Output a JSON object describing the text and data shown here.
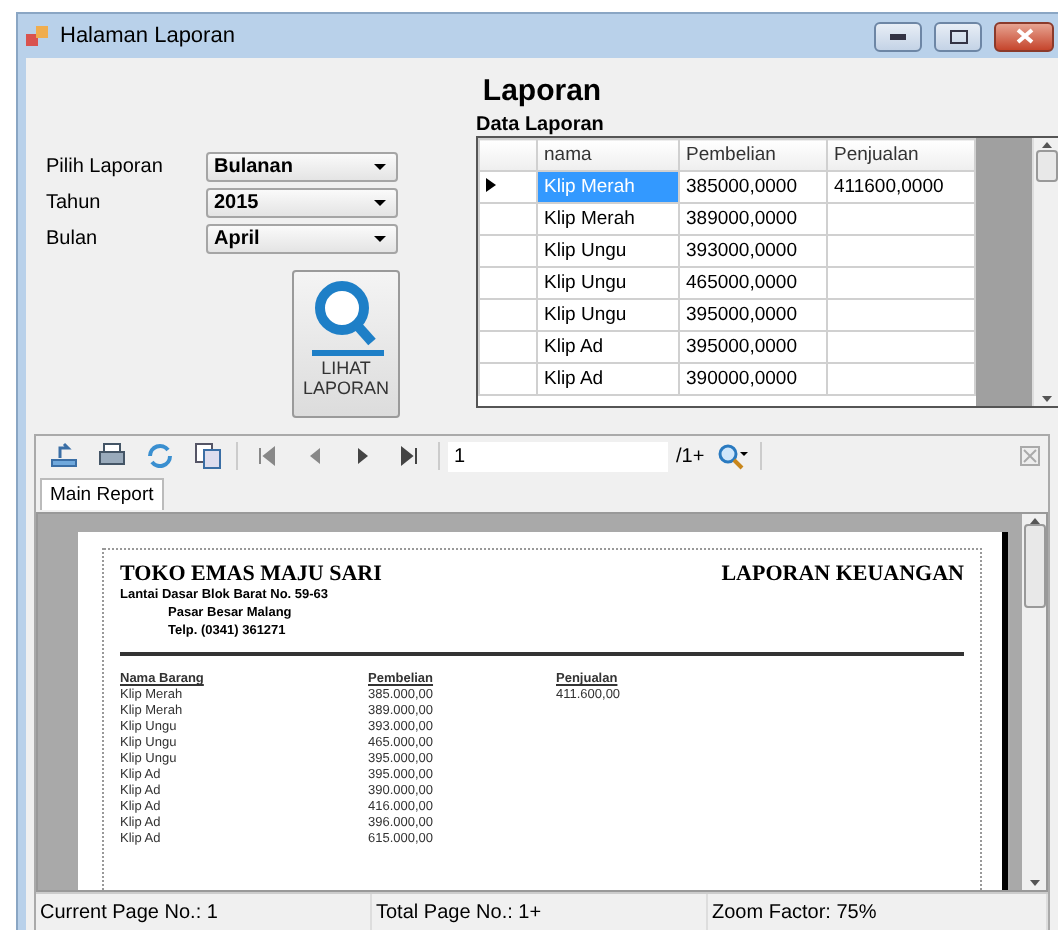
{
  "window": {
    "title": "Halaman Laporan"
  },
  "heading": "Laporan",
  "filters": [
    {
      "label": "Pilih Laporan",
      "value": "Bulanan"
    },
    {
      "label": "Tahun",
      "value": "2015"
    },
    {
      "label": "Bulan",
      "value": "April"
    }
  ],
  "view_button": "LIHAT LAPORAN",
  "grid": {
    "title": "Data Laporan",
    "columns": [
      "nama",
      "Pembelian",
      "Penjualan"
    ],
    "rows": [
      {
        "selected": true,
        "cells": [
          "Klip Merah",
          "385000,0000",
          "411600,0000"
        ]
      },
      {
        "selected": false,
        "cells": [
          "Klip Merah",
          "389000,0000",
          ""
        ]
      },
      {
        "selected": false,
        "cells": [
          "Klip Ungu",
          "393000,0000",
          ""
        ]
      },
      {
        "selected": false,
        "cells": [
          "Klip Ungu",
          "465000,0000",
          ""
        ]
      },
      {
        "selected": false,
        "cells": [
          "Klip Ungu",
          "395000,0000",
          ""
        ]
      },
      {
        "selected": false,
        "cells": [
          "Klip Ad",
          "395000,0000",
          ""
        ]
      },
      {
        "selected": false,
        "cells": [
          "Klip Ad",
          "390000,0000",
          ""
        ]
      }
    ]
  },
  "viewer": {
    "page_field": "1",
    "page_total": "/1+",
    "tab": "Main Report",
    "report": {
      "store_name": "TOKO EMAS MAJU SARI",
      "address_lines": [
        "Lantai Dasar Blok Barat No. 59-63",
        "Pasar Besar Malang",
        "Telp. (0341) 361271"
      ],
      "title": "LAPORAN KEUANGAN",
      "columns": [
        "Nama Barang",
        "Pembelian",
        "Penjualan"
      ],
      "rows": [
        [
          "Klip Merah",
          "385.000,00",
          "411.600,00"
        ],
        [
          "Klip Merah",
          "389.000,00",
          ""
        ],
        [
          "Klip Ungu",
          "393.000,00",
          ""
        ],
        [
          "Klip Ungu",
          "465.000,00",
          ""
        ],
        [
          "Klip Ungu",
          "395.000,00",
          ""
        ],
        [
          "Klip Ad",
          "395.000,00",
          ""
        ],
        [
          "Klip Ad",
          "390.000,00",
          ""
        ],
        [
          "Klip Ad",
          "416.000,00",
          ""
        ],
        [
          "Klip Ad",
          "396.000,00",
          ""
        ],
        [
          "Klip Ad",
          "615.000,00",
          ""
        ]
      ]
    }
  },
  "status_bar": [
    "Current Page No.: 1",
    "Total Page No.: 1+",
    "Zoom Factor: 75%"
  ]
}
